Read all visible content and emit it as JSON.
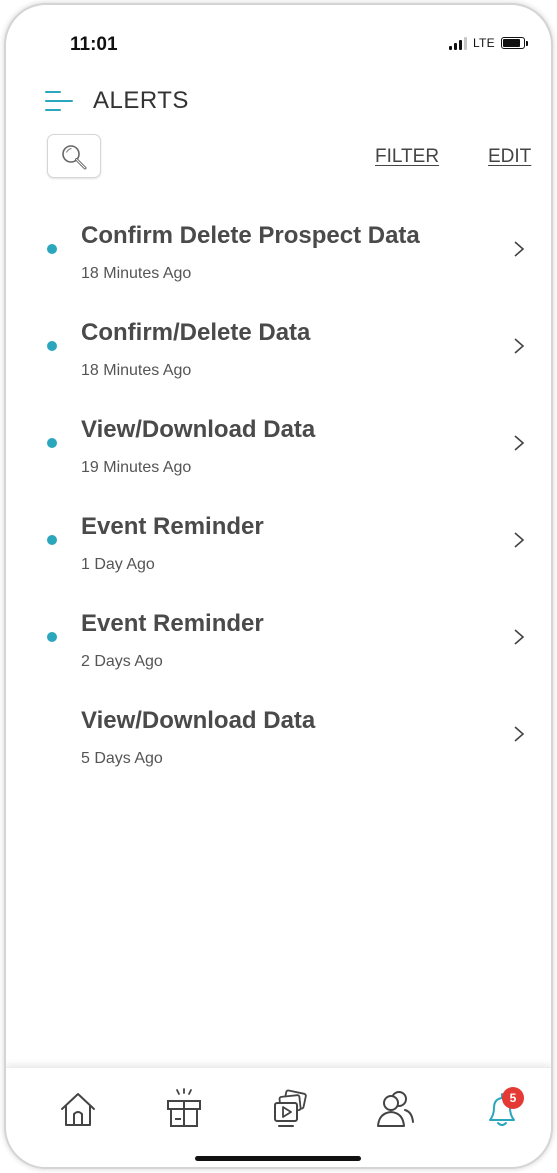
{
  "status_bar": {
    "time": "11:01",
    "network": "LTE",
    "icons": [
      "signal-icon",
      "battery-icon"
    ]
  },
  "header": {
    "title": "ALERTS",
    "menu_icon": "hamburger-menu-icon"
  },
  "toolbar": {
    "search_icon": "search-icon",
    "filter_label": "FILTER",
    "edit_label": "EDIT"
  },
  "alerts": [
    {
      "title": "Confirm Delete Prospect Data",
      "time": "18 Minutes Ago",
      "unread": true
    },
    {
      "title": "Confirm/Delete Data",
      "time": "18 Minutes Ago",
      "unread": true
    },
    {
      "title": "View/Download Data",
      "time": "19 Minutes Ago",
      "unread": true
    },
    {
      "title": "Event Reminder",
      "time": "1 Day Ago",
      "unread": true
    },
    {
      "title": "Event Reminder",
      "time": "2 Days Ago",
      "unread": true
    },
    {
      "title": "View/Download Data",
      "time": "5 Days Ago",
      "unread": false
    }
  ],
  "bottom_nav": {
    "items": [
      "home-icon",
      "gift-icon",
      "media-icon",
      "contacts-icon",
      "bell-icon"
    ],
    "active": "bell-icon",
    "badge_count": "5"
  },
  "colors": {
    "accent": "#2aa7bd",
    "badge": "#e53935",
    "title_text": "#4a4a4a",
    "secondary_text": "#555555"
  }
}
